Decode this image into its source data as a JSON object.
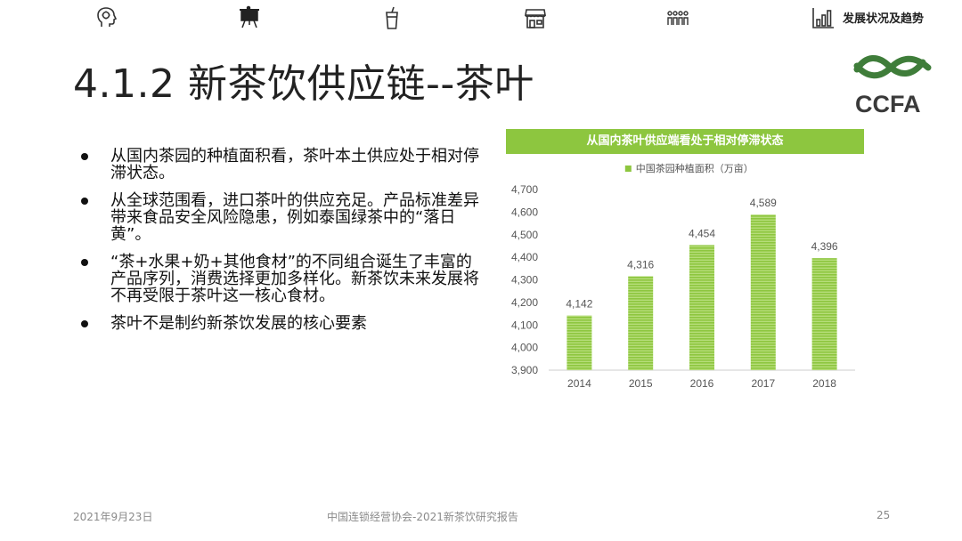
{
  "nav": {
    "icons": [
      "brain-head-icon",
      "presentation-board-icon",
      "drink-cup-icon",
      "storefront-icon",
      "people-group-icon",
      "bar-chart-icon"
    ],
    "active_label": "发展状况及趋势"
  },
  "title": "4.1.2 新茶饮供应链--茶叶",
  "logo_text": "CCFA",
  "bullets": [
    "从国内茶园的种植面积看，茶叶本土供应处于相对停滞状态。",
    "从全球范围看，进口茶叶的供应充足。产品标准差异带来食品安全风险隐患，例如泰国绿茶中的“落日黄”。",
    "“茶+水果+奶+其他食材”的不同组合诞生了丰富的产品序列，消费选择更加多样化。新茶饮未来发展将不再受限于茶叶这一核心食材。",
    "茶叶不是制约新茶饮发展的核心要素"
  ],
  "chart_data": {
    "type": "bar",
    "title": "从国内茶叶供应端看处于相对停滞状态",
    "series": [
      {
        "name": "中国茶园种植面积（万亩）",
        "values": [
          4142,
          4316,
          4454,
          4589,
          4396
        ]
      }
    ],
    "categories": [
      "2014",
      "2015",
      "2016",
      "2017",
      "2018"
    ],
    "data_labels": [
      "4,142",
      "4,316",
      "4,454",
      "4,589",
      "4,396"
    ],
    "ylim": [
      3900,
      4700
    ],
    "yticks": [
      3900,
      4000,
      4100,
      4200,
      4300,
      4400,
      4500,
      4600,
      4700
    ],
    "ytick_labels": [
      "3,900",
      "4,000",
      "4,100",
      "4,200",
      "4,300",
      "4,400",
      "4,500",
      "4,600",
      "4,700"
    ],
    "legend_position": "top",
    "grid": false,
    "bar_color": "#8dc63f"
  },
  "footer": {
    "date": "2021年9月23日",
    "source": "中国连锁经营协会-2021新茶饮研究报告",
    "page": "25"
  }
}
